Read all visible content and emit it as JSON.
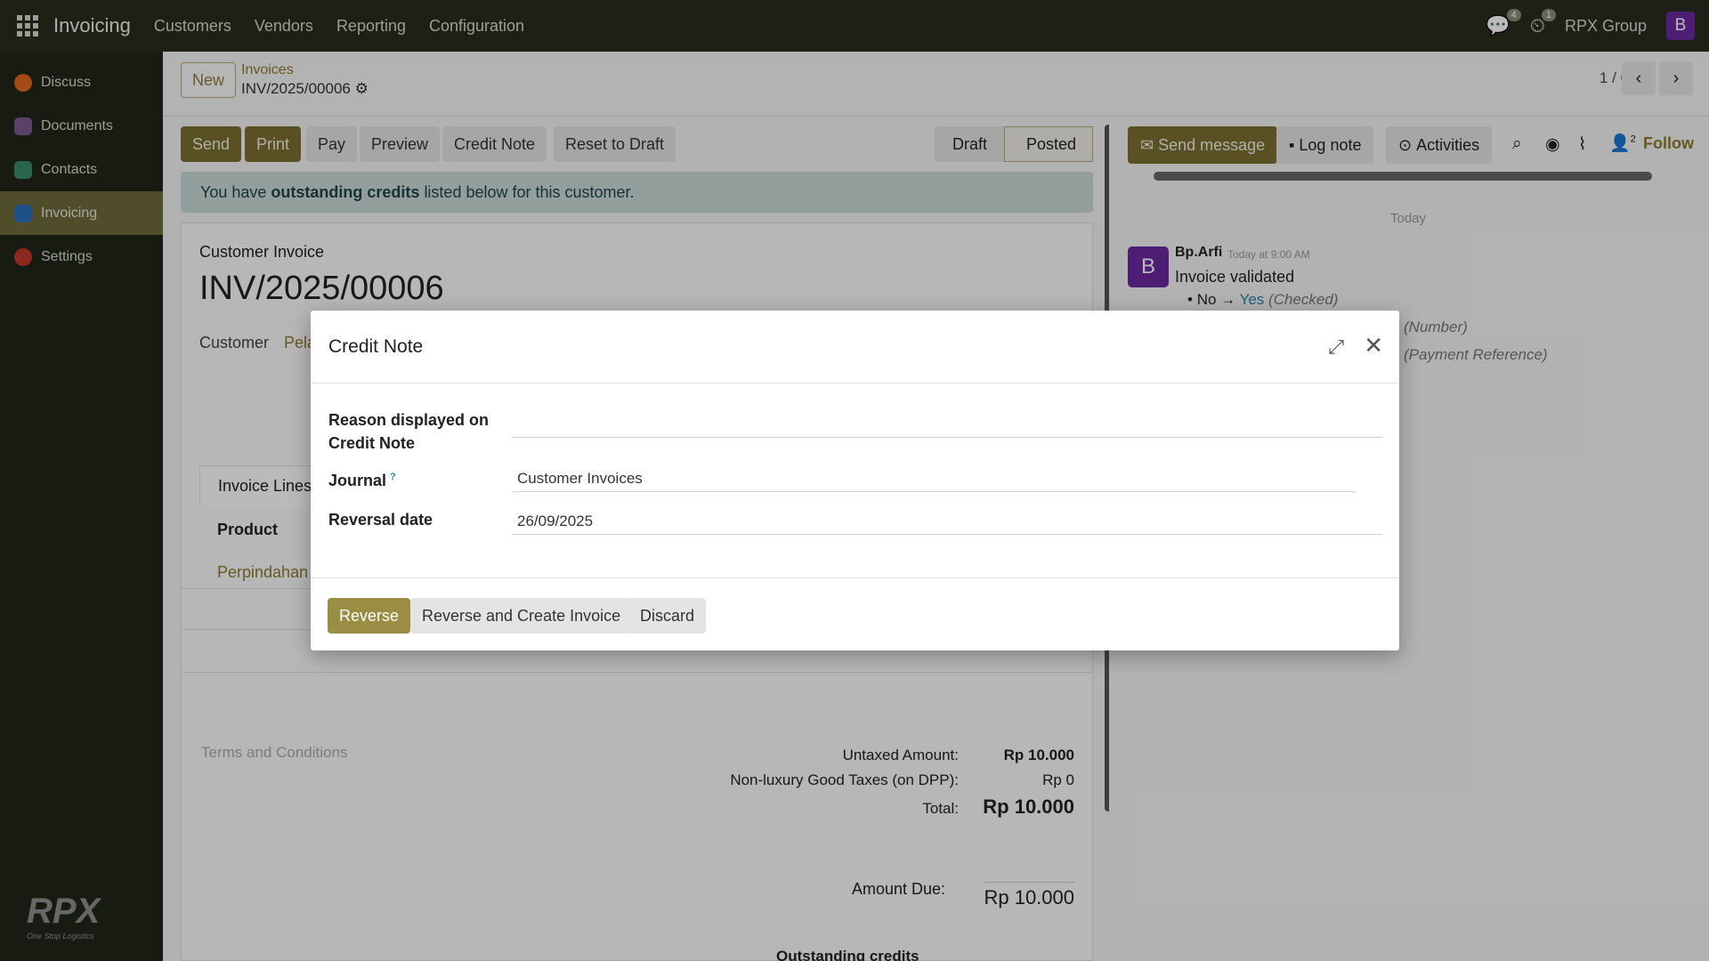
{
  "topbar": {
    "app": "Invoicing",
    "nav": [
      "Customers",
      "Vendors",
      "Reporting",
      "Configuration"
    ],
    "messages_count": "4",
    "activities_count": "1",
    "company": "RPX Group",
    "avatar": "B"
  },
  "sidebar": {
    "items": [
      {
        "label": "Discuss",
        "color": "#e0661c"
      },
      {
        "label": "Documents",
        "color": "#7a5a8e"
      },
      {
        "label": "Contacts",
        "color": "#3c8a6a"
      },
      {
        "label": "Invoicing",
        "color": "#2a6fb8"
      },
      {
        "label": "Settings",
        "color": "#c0392b"
      }
    ],
    "logo": "RPX",
    "tagline": "One Stop Logistics"
  },
  "control": {
    "new_label": "New",
    "breadcrumb": "Invoices",
    "record": "INV/2025/00006",
    "pager": "1 / 6"
  },
  "toolbar": {
    "send": "Send",
    "print": "Print",
    "pay": "Pay",
    "preview": "Preview",
    "credit_note": "Credit Note",
    "reset": "Reset to Draft"
  },
  "status": {
    "draft": "Draft",
    "posted": "Posted"
  },
  "alert": {
    "prefix": "You have ",
    "bold": "outstanding credits",
    "suffix": " listed below for this customer."
  },
  "form": {
    "type": "Customer Invoice",
    "number": "INV/2025/00006",
    "customer_label": "Customer",
    "customer_value": "Pela",
    "tab": "Invoice Lines",
    "col_product": "Product",
    "line_product": "Perpindahan",
    "terms": "Terms and Conditions",
    "untaxed_label": "Untaxed Amount:",
    "untaxed_value": "Rp 10.000",
    "tax_label": "Non-luxury Good Taxes (on DPP):",
    "tax_value": "Rp 0",
    "total_label": "Total:",
    "total_value": "Rp 10.000",
    "due_label": "Amount Due:",
    "due_value": "Rp 10.000",
    "outstanding": "Outstanding credits"
  },
  "chatter": {
    "send_message": "Send message",
    "log_note": "Log note",
    "activities": "Activities",
    "followers": "2",
    "follow": "Follow",
    "today": "Today",
    "author": "Bp.Arfi",
    "time": "Today at 9:00 AM",
    "avatar": "B",
    "message": "Invoice validated",
    "change_old": "No",
    "change_new": "Yes",
    "change_field": "(Checked)",
    "field2": "(Number)",
    "field3": "(Payment Reference)"
  },
  "modal": {
    "title": "Credit Note",
    "reason_label": "Reason displayed on Credit Note",
    "journal_label": "Journal",
    "journal_help": "?",
    "journal_value": "Customer Invoices",
    "date_label": "Reversal date",
    "date_value": "26/09/2025",
    "reverse": "Reverse",
    "reverse_create": "Reverse and Create Invoice",
    "discard": "Discard"
  }
}
